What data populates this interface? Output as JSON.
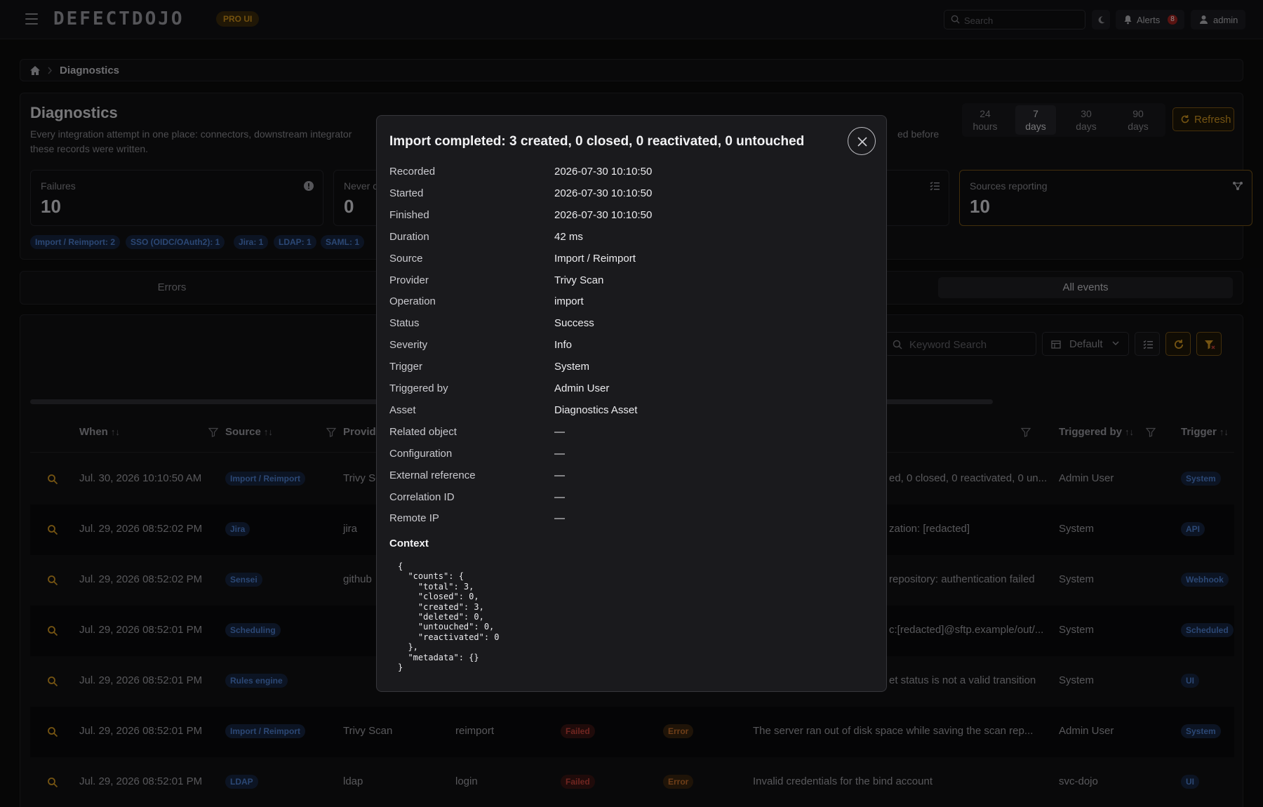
{
  "topbar": {
    "logo": "DEFECTDOJO",
    "badge": "PRO UI",
    "search_placeholder": "Search",
    "alerts_label": "Alerts",
    "alerts_count": "8",
    "user": "admin"
  },
  "breadcrumb": {
    "current": "Diagnostics"
  },
  "page": {
    "title": "Diagnostics",
    "desc_visible": "Every integration attempt in one place: connectors, downstream integrator",
    "desc_line2": "these records were written.",
    "desc_tail": "ed before"
  },
  "time_ranges": [
    {
      "line1": "24",
      "line2": "hours"
    },
    {
      "line1": "7",
      "line2": "days"
    },
    {
      "line1": "30",
      "line2": "days"
    },
    {
      "line1": "90",
      "line2": "days"
    }
  ],
  "refresh_label": "Refresh",
  "stats": [
    {
      "label": "Failures",
      "value": "10"
    },
    {
      "label": "Never c",
      "value": "0"
    },
    {
      "label": "Sources reporting",
      "value": "10"
    }
  ],
  "chips": [
    "Import / Reimport: 2",
    "SSO (OIDC/OAuth2): 1",
    "Jira: 1",
    "LDAP: 1",
    "SAML: 1"
  ],
  "tabs": [
    "Errors",
    "All events"
  ],
  "grid": {
    "keyword_placeholder": "Keyword Search",
    "view_label": "Default",
    "headers": {
      "when": "When",
      "source": "Source",
      "provider": "Provide",
      "triggered_by": "Triggered by",
      "trigger": "Trigger"
    },
    "rows": [
      {
        "when": "Jul. 30, 2026 10:10:50 AM",
        "source": "Import / Reimport",
        "provider": "Trivy Sc",
        "operation": "",
        "status": "",
        "severity": "",
        "message": "ed, 0 closed, 0 reactivated, 0 un...",
        "by": "Admin User",
        "trigger": "System"
      },
      {
        "when": "Jul. 29, 2026 08:52:02 PM",
        "source": "Jira",
        "provider": "jira",
        "operation": "",
        "status": "",
        "severity": "",
        "message": "zation: [redacted]",
        "by": "System",
        "trigger": "API"
      },
      {
        "when": "Jul. 29, 2026 08:52:02 PM",
        "source": "Sensei",
        "provider": "github",
        "operation": "",
        "status": "",
        "severity": "",
        "message": " repository: authentication failed",
        "by": "System",
        "trigger": "Webhook"
      },
      {
        "when": "Jul. 29, 2026 08:52:01 PM",
        "source": "Scheduling",
        "provider": "",
        "operation": "",
        "status": "",
        "severity": "",
        "message": "c:[redacted]@sftp.example/out/...",
        "by": "System",
        "trigger": "Scheduled"
      },
      {
        "when": "Jul. 29, 2026 08:52:01 PM",
        "source": "Rules engine",
        "provider": "",
        "operation": "",
        "status": "",
        "severity": "",
        "message": "et status is not a valid transition",
        "by": "System",
        "trigger": "UI"
      },
      {
        "when": "Jul. 29, 2026 08:52:01 PM",
        "source": "Import / Reimport",
        "provider": "Trivy Scan",
        "operation": "reimport",
        "status": "Failed",
        "severity": "Error",
        "message": "The server ran out of disk space while saving the scan rep...",
        "by": "Admin User",
        "trigger": "System"
      },
      {
        "when": "Jul. 29, 2026 08:52:01 PM",
        "source": "LDAP",
        "provider": "ldap",
        "operation": "login",
        "status": "Failed",
        "severity": "Error",
        "message": "Invalid credentials for the bind account",
        "by": "svc-dojo",
        "trigger": "UI"
      }
    ]
  },
  "modal": {
    "title": "Import completed: 3 created, 0 closed, 0 reactivated, 0 untouched",
    "fields": [
      {
        "k": "Recorded",
        "v": "2026-07-30 10:10:50"
      },
      {
        "k": "Started",
        "v": "2026-07-30 10:10:50"
      },
      {
        "k": "Finished",
        "v": "2026-07-30 10:10:50"
      },
      {
        "k": "Duration",
        "v": "42 ms"
      },
      {
        "k": "Source",
        "v": "Import / Reimport"
      },
      {
        "k": "Provider",
        "v": "Trivy Scan"
      },
      {
        "k": "Operation",
        "v": "import"
      },
      {
        "k": "Status",
        "v": "Success"
      },
      {
        "k": "Severity",
        "v": "Info"
      },
      {
        "k": "Trigger",
        "v": "System"
      },
      {
        "k": "Triggered by",
        "v": "Admin User"
      },
      {
        "k": "Asset",
        "v": "Diagnostics Asset"
      },
      {
        "k": "Related object",
        "v": "—"
      },
      {
        "k": "Configuration",
        "v": "—"
      },
      {
        "k": "External reference",
        "v": "—"
      },
      {
        "k": "Correlation ID",
        "v": "—"
      },
      {
        "k": "Remote IP",
        "v": "—"
      }
    ],
    "context_title": "Context",
    "context_json": "{\n  \"counts\": {\n    \"total\": 3,\n    \"closed\": 0,\n    \"created\": 3,\n    \"deleted\": 0,\n    \"untouched\": 0,\n    \"reactivated\": 0\n  },\n  \"metadata\": {}\n}"
  }
}
